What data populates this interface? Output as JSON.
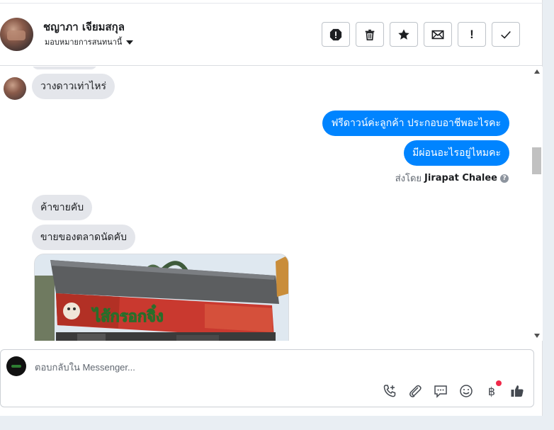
{
  "header": {
    "contact_name": "ชญาภา เจียมสกุล",
    "assign_label": "มอบหมายการสนทนานี้"
  },
  "actions": [
    {
      "name": "spam-icon"
    },
    {
      "name": "trash-icon"
    },
    {
      "name": "star-icon"
    },
    {
      "name": "envelope-icon"
    },
    {
      "name": "follow-up-icon",
      "label": "!"
    },
    {
      "name": "done-check-icon"
    }
  ],
  "messages": {
    "incoming_1": "วางดาวเท่าไหร่",
    "outgoing_1": "ฟรีดาวน์ค่ะลูกค้า ประกอบอาชีพอะไรคะ",
    "outgoing_2": "มีผ่อนอะไรอยู่ไหมคะ",
    "sent_by_prefix": "ส่งโดย",
    "sent_by_name": "Jirapat Chalee",
    "incoming_2": "ค้าขายคับ",
    "incoming_3": "ขายของตลาดนัดคับ",
    "photo_sign_text": "ไส้กรอกจิ๋ง"
  },
  "composer": {
    "placeholder": "ตอบกลับใน Messenger...",
    "tools": [
      "phone-add-icon",
      "paperclip-icon",
      "saved-reply-icon",
      "emoji-icon",
      "baht-payment-icon",
      "thumbs-up-icon"
    ],
    "baht_symbol": "฿"
  },
  "colors": {
    "outgoing_bubble": "#0084ff",
    "incoming_bubble": "#e4e6eb",
    "notification_dot": "#f02849"
  }
}
